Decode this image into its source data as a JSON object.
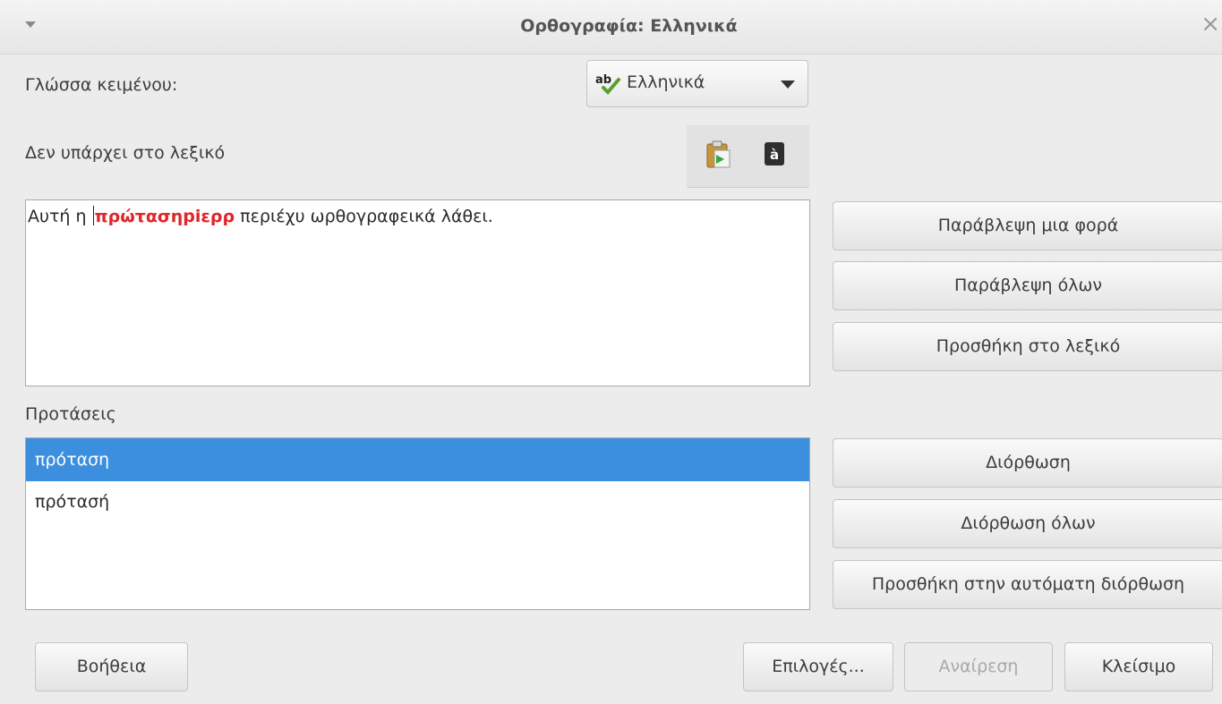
{
  "window": {
    "title": "Ορθογραφία: Ελληνικά"
  },
  "language": {
    "label": "Γλώσσα κειμένου:",
    "selected": "Ελληνικά"
  },
  "not_in_dictionary": {
    "label": "Δεν υπάρχει στο λεξικό"
  },
  "sentence": {
    "before": "Αυτή η ",
    "error_word": "πρώτασηpiερρ",
    "after": " περιέχυ ωρθογραφεικά λάθει."
  },
  "side_buttons": {
    "ignore_once": "Παράβλεψη μια φορά",
    "ignore_all": "Παράβλεψη όλων",
    "add_to_dictionary": "Προσθήκη στο λεξικό",
    "correct": "Διόρθωση",
    "correct_all": "Διόρθωση όλων",
    "add_autocorrect": "Προσθήκη στην αυτόματη διόρθωση"
  },
  "suggestions": {
    "label": "Προτάσεις",
    "items": [
      "πρόταση",
      "πρότασή"
    ]
  },
  "bottom_buttons": {
    "help": "Βοήθεια",
    "options": "Επιλογές...",
    "undo": "Αναίρεση",
    "close": "Κλείσιμο"
  },
  "colors": {
    "error": "#e0262a",
    "selection": "#3c8fde"
  }
}
